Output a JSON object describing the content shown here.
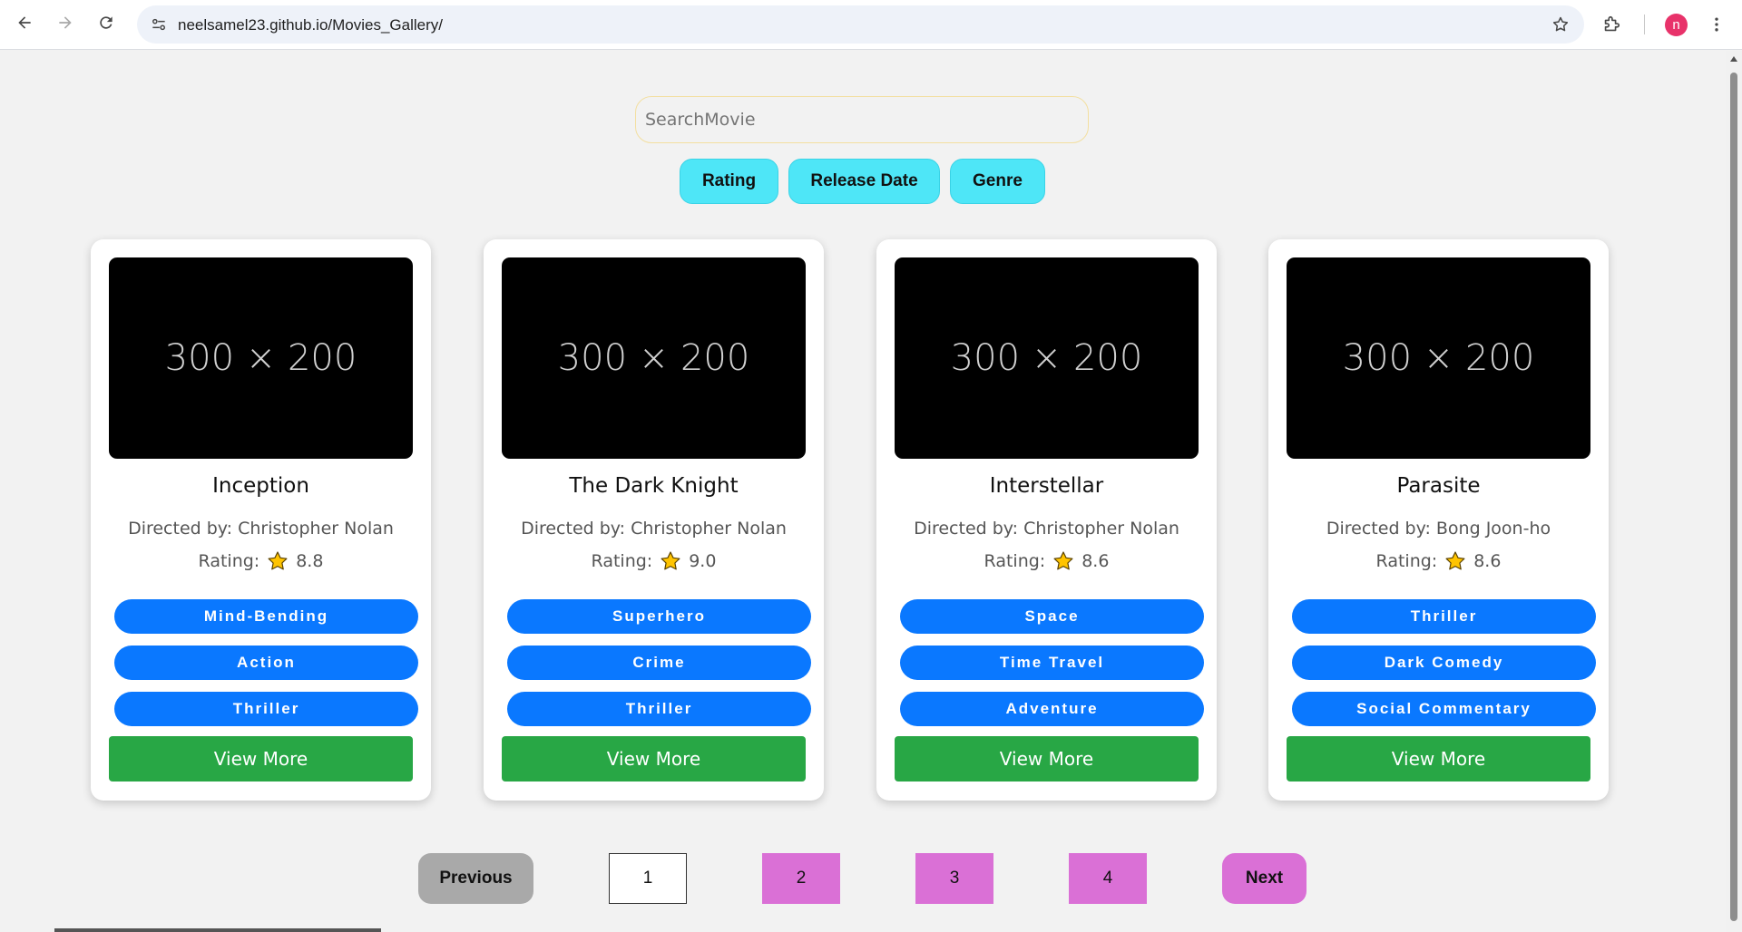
{
  "browser": {
    "url": "neelsamel23.github.io/Movies_Gallery/",
    "profile_initial": "n"
  },
  "search": {
    "placeholder": "SearchMovie",
    "value": ""
  },
  "filters": [
    "Rating",
    "Release Date",
    "Genre"
  ],
  "movies": [
    {
      "poster_text": "300 × 200",
      "title": "Inception",
      "director": "Directed by: Christopher Nolan",
      "rating_label": "Rating:",
      "rating": "8.8",
      "tags": [
        "Mind-Bending",
        "Action",
        "Thriller"
      ],
      "button": "View More"
    },
    {
      "poster_text": "300 × 200",
      "title": "The Dark Knight",
      "director": "Directed by: Christopher Nolan",
      "rating_label": "Rating:",
      "rating": "9.0",
      "tags": [
        "Superhero",
        "Crime",
        "Thriller"
      ],
      "button": "View More"
    },
    {
      "poster_text": "300 × 200",
      "title": "Interstellar",
      "director": "Directed by: Christopher Nolan",
      "rating_label": "Rating:",
      "rating": "8.6",
      "tags": [
        "Space",
        "Time Travel",
        "Adventure"
      ],
      "button": "View More"
    },
    {
      "poster_text": "300 × 200",
      "title": "Parasite",
      "director": "Directed by: Bong Joon-ho",
      "rating_label": "Rating:",
      "rating": "8.6",
      "tags": [
        "Thriller",
        "Dark Comedy",
        "Social Commentary"
      ],
      "button": "View More"
    }
  ],
  "pagination": {
    "previous": "Previous",
    "pages": [
      "1",
      "2",
      "3",
      "4"
    ],
    "current": "1",
    "next": "Next"
  },
  "colors": {
    "filter_bg": "#4ee6f7",
    "tag_bg": "#0a78ff",
    "view_more_bg": "#28a745",
    "page_btn_bg": "#da70d6",
    "previous_bg": "#a9a9a9",
    "avatar_bg": "#e8326a"
  },
  "icons": [
    "back-arrow-icon",
    "forward-arrow-icon",
    "reload-icon",
    "site-info-icon",
    "bookmark-star-icon",
    "extensions-icon",
    "kebab-menu-icon",
    "rating-star-icon"
  ]
}
